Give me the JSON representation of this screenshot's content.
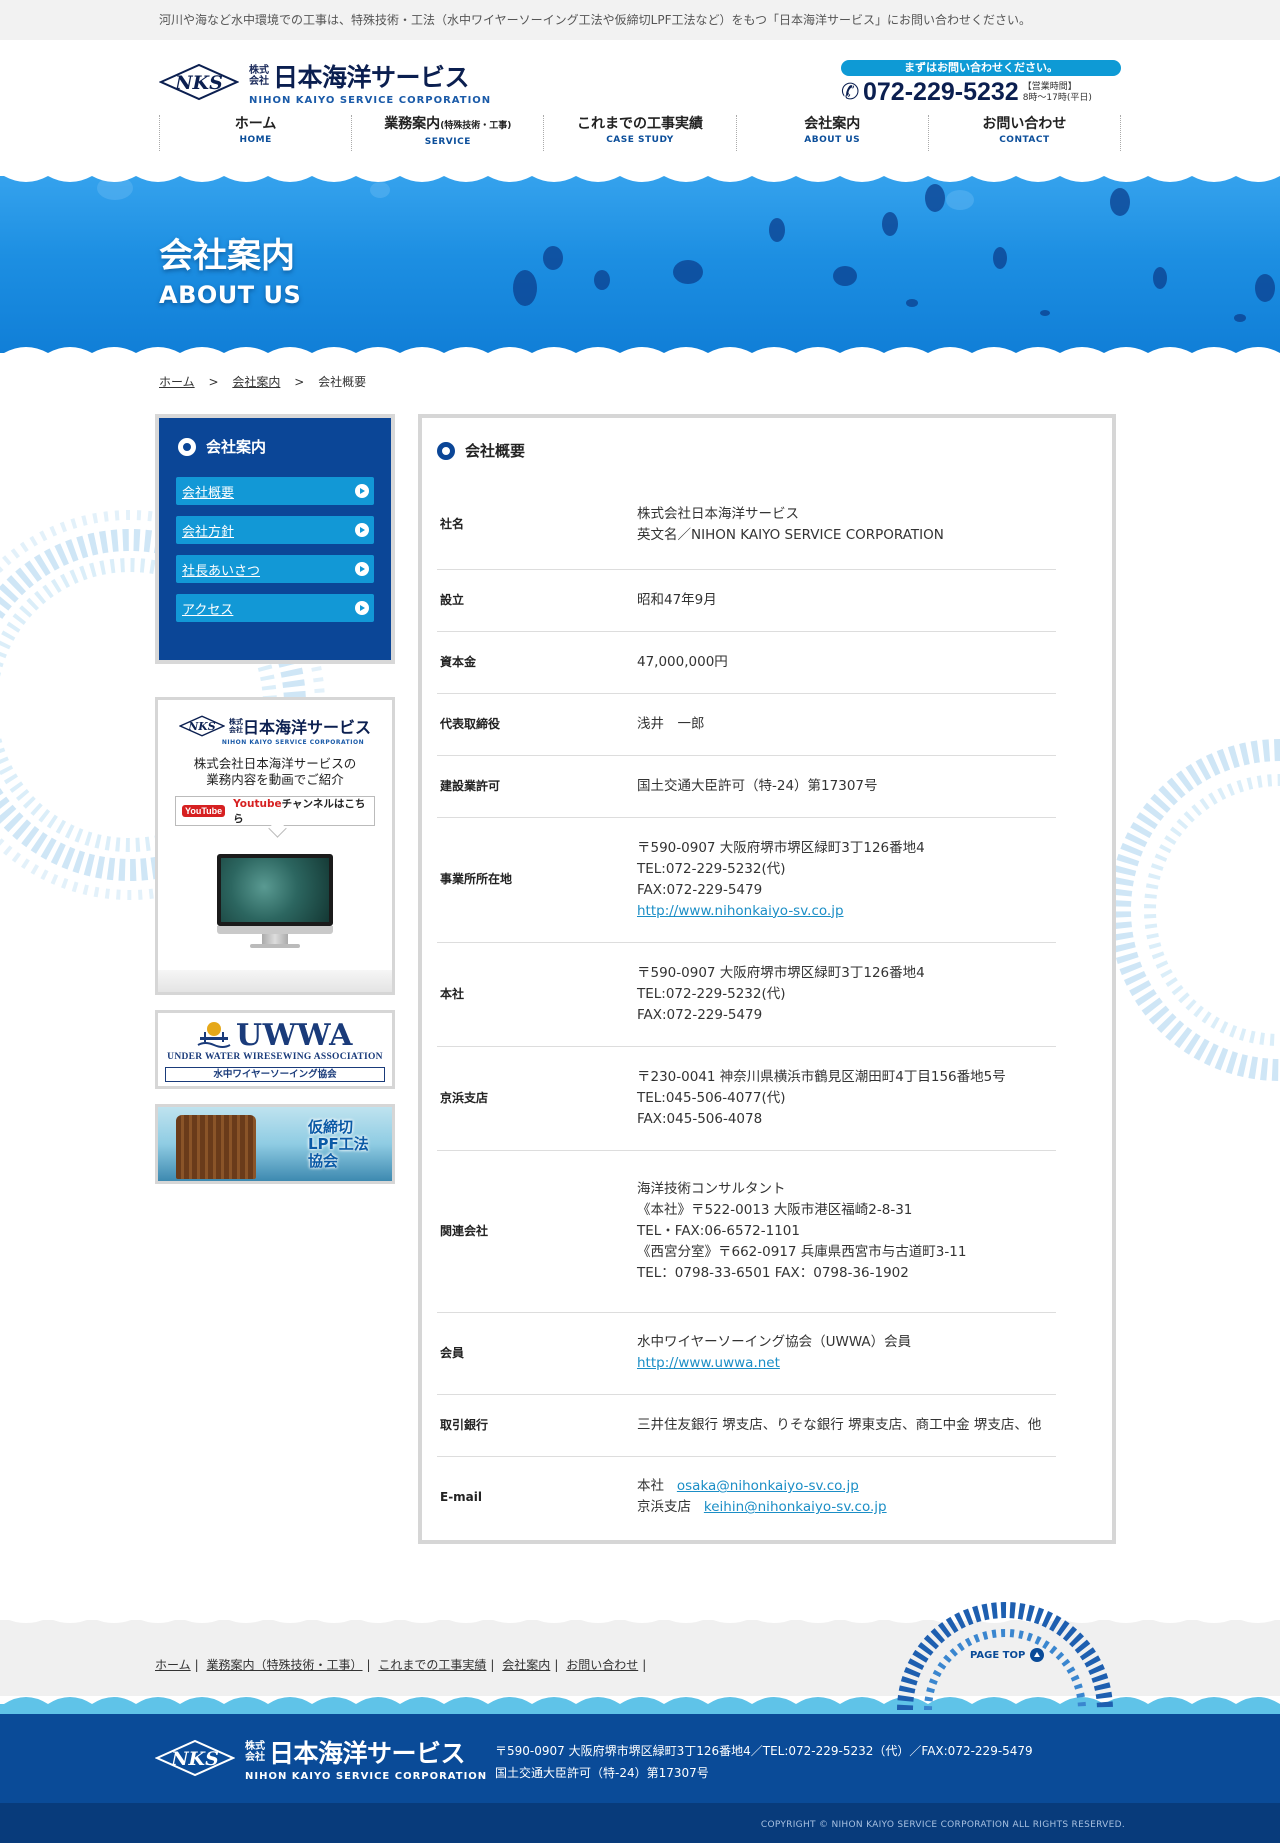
{
  "topbar": {
    "notice": "河川や海など水中環境での工事は、特殊技術・工法（水中ワイヤーソーイング工法や仮締切LPF工法など）をもつ「日本海洋サービス」にお問い合わせください。"
  },
  "brand": {
    "mark": "NKS",
    "kk": "株式会社",
    "name_jp": "日本海洋サービス",
    "name_en": "NIHON KAIYO SERVICE CORPORATION"
  },
  "contact": {
    "pill": "まずはお問い合わせください。",
    "phone": "072-229-5232",
    "hours_line1": "【営業時間】",
    "hours_line2": "8時〜17時(平日)"
  },
  "nav": [
    {
      "jp": "ホーム",
      "sub": "",
      "en": "HOME"
    },
    {
      "jp": "業務案内",
      "sub": "(特殊技術・工事)",
      "en": "SERVICE"
    },
    {
      "jp": "これまでの工事実績",
      "sub": "",
      "en": "CASE STUDY"
    },
    {
      "jp": "会社案内",
      "sub": "",
      "en": "ABOUT US"
    },
    {
      "jp": "お問い合わせ",
      "sub": "",
      "en": "CONTACT"
    }
  ],
  "hero": {
    "title_jp": "会社案内",
    "title_en": "ABOUT US"
  },
  "breadcrumb": {
    "home": "ホーム",
    "sep": ">",
    "parent": "会社案内",
    "current": "会社概要"
  },
  "sidebar": {
    "heading": "会社案内",
    "links": [
      "会社概要",
      "会社方針",
      "社長あいさつ",
      "アクセス"
    ],
    "video": {
      "desc_line1": "株式会社日本海洋サービスの",
      "desc_line2": "業務内容を動画でご紹介",
      "yt_logo": "YouTube",
      "yt_brand": "Youtube",
      "yt_rest": "チャンネルはこちら"
    },
    "uwwa": {
      "title": "UWWA",
      "en": "UNDER WATER WIRESEWING ASSOCIATION",
      "jp": "水中ワイヤーソーイング協会"
    },
    "lpf": {
      "line1": "仮締切",
      "line2": "LPF工法",
      "line3": "協会"
    }
  },
  "main": {
    "heading": "会社概要",
    "rows": [
      {
        "key": "社名",
        "lines": [
          "株式会社日本海洋サービス",
          "英文名／NIHON KAIYO SERVICE CORPORATION"
        ]
      },
      {
        "key": "設立",
        "lines": [
          "昭和47年9月"
        ]
      },
      {
        "key": "資本金",
        "lines": [
          "47,000,000円"
        ]
      },
      {
        "key": "代表取締役",
        "lines": [
          "浅井　一郎"
        ]
      },
      {
        "key": "建設業許可",
        "lines": [
          "国土交通大臣許可（特-24）第17307号"
        ]
      },
      {
        "key": "事業所所在地",
        "lines": [
          "〒590-0907 大阪府堺市堺区緑町3丁126番地4",
          "TEL:072-229-5232(代)",
          "FAX:072-229-5479"
        ],
        "link": "http://www.nihonkaiyo-sv.co.jp"
      },
      {
        "key": "本社",
        "lines": [
          "〒590-0907 大阪府堺市堺区緑町3丁126番地4",
          "TEL:072-229-5232(代)",
          "FAX:072-229-5479"
        ]
      },
      {
        "key": "京浜支店",
        "lines": [
          "〒230-0041 神奈川県横浜市鶴見区潮田町4丁目156番地5号",
          "TEL:045-506-4077(代)",
          "FAX:045-506-4078"
        ]
      },
      {
        "key": "関連会社",
        "lines": [
          "海洋技術コンサルタント",
          "《本社》〒522-0013 大阪市港区福崎2-8-31",
          "TEL・FAX:06-6572-1101",
          "《西宮分室》〒662-0917 兵庫県西宮市与古道町3-11",
          "TEL：0798-33-6501 FAX：0798-36-1902"
        ]
      },
      {
        "key": "会員",
        "lines": [
          "水中ワイヤーソーイング協会（UWWA）会員"
        ],
        "link": "http://www.uwwa.net"
      },
      {
        "key": "取引銀行",
        "lines": [
          "三井住友銀行 堺支店、りそな銀行 堺東支店、商工中金 堺支店、他"
        ]
      },
      {
        "key": "E-mail",
        "emails": [
          {
            "label": "本社",
            "addr": "osaka@nihonkaiyo-sv.co.jp"
          },
          {
            "label": "京浜支店",
            "addr": "keihin@nihonkaiyo-sv.co.jp"
          }
        ]
      }
    ]
  },
  "footer": {
    "links": [
      "ホーム",
      "業務案内（特殊技術・工事）",
      "これまでの工事実績",
      "会社案内",
      "お問い合わせ"
    ],
    "pagetop": "PAGE TOP",
    "address": "〒590-0907 大阪府堺市堺区緑町3丁126番地4／TEL:072-229-5232（代）／FAX:072-229-5479",
    "license": "国土交通大臣許可（特-24）第17307号",
    "copyright": "COPYRIGHT © NIHON KAIYO SERVICE CORPORATION ALL RIGHTS RESERVED."
  },
  "colors": {
    "brand_navy": "#0b1f50",
    "accent_blue": "#0e9ad5",
    "sidebar_blue": "#0b4697",
    "footer_blue": "#0a4b98"
  }
}
